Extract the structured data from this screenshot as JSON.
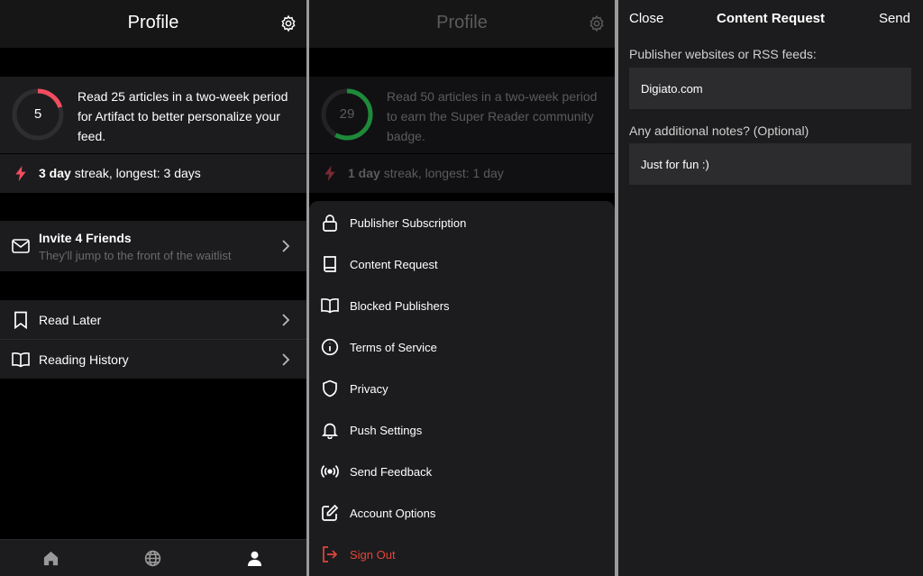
{
  "colors": {
    "accent_red": "#f24d5f",
    "accent_green": "#1e8a3a",
    "danger": "#e0463a",
    "muted": "#6a6a6a"
  },
  "profile": {
    "title": "Profile",
    "progress": {
      "count": "5",
      "fraction": 0.2,
      "goal_text": "Read 25 articles in a two-week period for Artifact to better personalize your feed."
    },
    "streak": {
      "bold": "3 day",
      "rest": " streak, longest: 3 days"
    },
    "invite": {
      "title": "Invite 4 Friends",
      "subtitle": "They'll jump to the front of the waitlist"
    },
    "list": [
      {
        "label": "Read Later",
        "icon": "bookmark-icon"
      },
      {
        "label": "Reading History",
        "icon": "book-open-icon"
      }
    ],
    "tabs": [
      "home-icon",
      "globe-icon",
      "person-icon"
    ]
  },
  "settings": {
    "title": "Profile",
    "progress": {
      "count": "29",
      "fraction": 0.58,
      "goal_text": "Read 50 articles in a two-week period to earn the Super Reader community badge."
    },
    "streak": {
      "bold": "1 day",
      "rest": " streak, longest: 1 day"
    },
    "menu": [
      {
        "label": "Publisher Subscription",
        "icon": "lock-icon"
      },
      {
        "label": "Content Request",
        "icon": "book-icon"
      },
      {
        "label": "Blocked Publishers",
        "icon": "book-open-icon"
      },
      {
        "label": "Terms of Service",
        "icon": "info-icon"
      },
      {
        "label": "Privacy",
        "icon": "shield-icon"
      },
      {
        "label": "Push Settings",
        "icon": "bell-icon"
      },
      {
        "label": "Send Feedback",
        "icon": "broadcast-icon"
      },
      {
        "label": "Account Options",
        "icon": "edit-icon"
      },
      {
        "label": "Sign Out",
        "icon": "sign-out-icon"
      }
    ]
  },
  "request": {
    "close": "Close",
    "title": "Content Request",
    "send": "Send",
    "publisher_label": "Publisher websites or RSS feeds:",
    "publisher_value": "Digiato.com",
    "notes_label": "Any additional notes? (Optional)",
    "notes_value": "Just for fun :)"
  }
}
